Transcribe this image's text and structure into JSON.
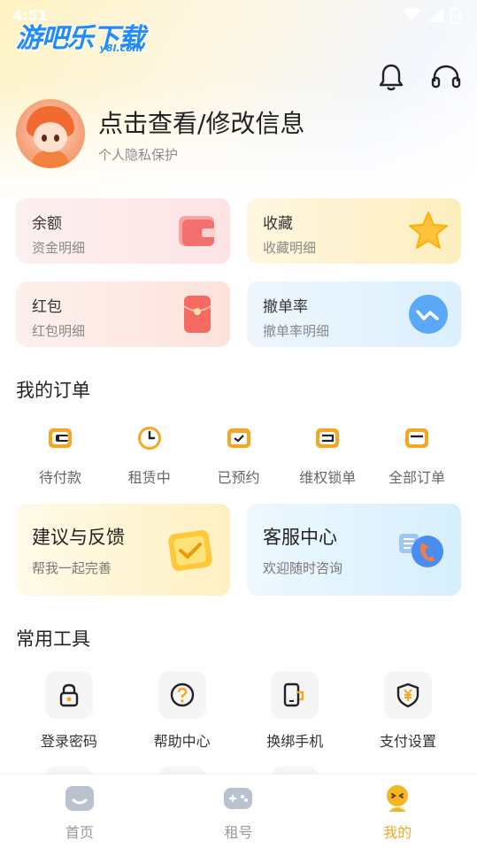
{
  "status_bar": {
    "time": "4:51"
  },
  "logo": {
    "text": "游吧乐下载",
    "sub": "y8l.com"
  },
  "profile": {
    "title": "点击查看/修改信息",
    "subtitle": "个人隐私保护"
  },
  "cards": [
    {
      "title": "余额",
      "subtitle": "资金明细"
    },
    {
      "title": "收藏",
      "subtitle": "收藏明细"
    },
    {
      "title": "红包",
      "subtitle": "红包明细"
    },
    {
      "title": "撤单率",
      "subtitle": "撤单率明细"
    }
  ],
  "orders": {
    "title": "我的订单",
    "items": [
      {
        "label": "待付款",
        "icon": "wallet-icon"
      },
      {
        "label": "租赁中",
        "icon": "clock-icon"
      },
      {
        "label": "已预约",
        "icon": "calendar-check-icon"
      },
      {
        "label": "维权锁单",
        "icon": "lock-order-icon"
      },
      {
        "label": "全部订单",
        "icon": "all-orders-icon"
      }
    ]
  },
  "big_cards": [
    {
      "title": "建议与反馈",
      "subtitle": "帮我一起完善"
    },
    {
      "title": "客服中心",
      "subtitle": "欢迎随时咨询"
    }
  ],
  "tools": {
    "title": "常用工具",
    "items": [
      {
        "label": "登录密码",
        "icon": "lock-icon"
      },
      {
        "label": "帮助中心",
        "icon": "help-icon"
      },
      {
        "label": "换绑手机",
        "icon": "phone-swap-icon"
      },
      {
        "label": "支付设置",
        "icon": "yuan-shield-icon"
      }
    ]
  },
  "tabbar": [
    {
      "label": "首页",
      "icon": "home-icon",
      "active": false
    },
    {
      "label": "租号",
      "icon": "gamepad-icon",
      "active": false
    },
    {
      "label": "我的",
      "icon": "profile-icon",
      "active": true
    }
  ],
  "colors": {
    "accent": "#f5a623",
    "orange_icon": "#f5a623",
    "brand_blue": "#1f8bff"
  }
}
